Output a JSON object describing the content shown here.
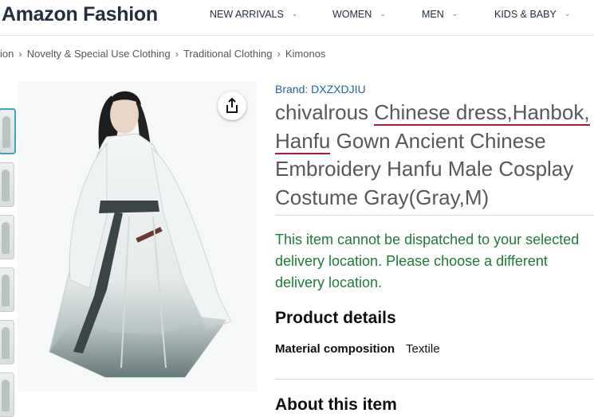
{
  "header": {
    "brand": "Amazon Fashion",
    "nav": [
      {
        "label": "NEW ARRIVALS"
      },
      {
        "label": "WOMEN"
      },
      {
        "label": "MEN"
      },
      {
        "label": "KIDS & BABY"
      }
    ]
  },
  "breadcrumb": [
    "ion",
    "Novelty & Special Use Clothing",
    "Traditional Clothing",
    "Kimonos"
  ],
  "product": {
    "brand_label": "Brand: DXZXDJIU",
    "title_parts": {
      "p1": "chivalrous ",
      "p2": "Chinese dress,Hanbok,",
      "p3": "Hanfu",
      "p4": " Gown Ancient Chinese Embroidery Hanfu Male Cosplay Costume Gray(Gray,M)"
    },
    "availability": "This item cannot be dispatched to your selected delivery location. Please choose a different delivery location.",
    "details_heading": "Product details",
    "details": [
      {
        "label": "Material composition",
        "value": "Textile"
      }
    ],
    "about_heading": "About this item"
  },
  "colors": {
    "brand_link": "#2162a1",
    "availability": "#1f7a3a",
    "underline_annotation": "#a81c3b",
    "thumb_selected": "#3fa3c2"
  },
  "icons": {
    "share": "share-icon",
    "chevron": "chevron-down-icon"
  }
}
